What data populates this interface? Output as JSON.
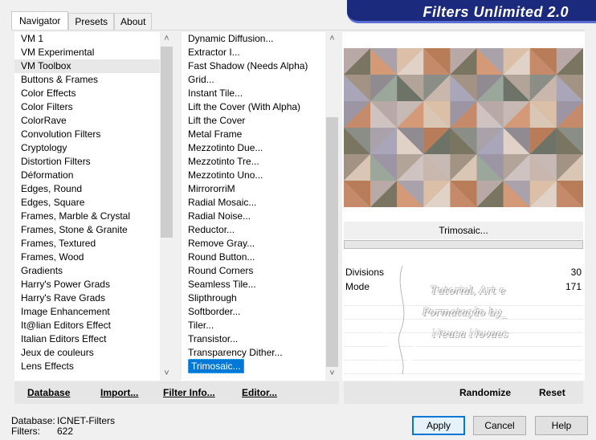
{
  "banner": {
    "title": "Filters Unlimited 2.0"
  },
  "tabs": [
    {
      "label": "Navigator",
      "active": true
    },
    {
      "label": "Presets",
      "active": false
    },
    {
      "label": "About",
      "active": false
    }
  ],
  "categories": [
    "VM 1",
    "VM Experimental",
    "VM Toolbox",
    "Buttons & Frames",
    "Color Effects",
    "Color Filters",
    "ColorRave",
    "Convolution Filters",
    "Cryptology",
    "Distortion Filters",
    "Déformation",
    "Edges, Round",
    "Edges, Square",
    "Frames, Marble & Crystal",
    "Frames, Stone & Granite",
    "Frames, Textured",
    "Frames, Wood",
    "Gradients",
    "Harry's Power Grads",
    "Harry's Rave Grads",
    "Image Enhancement",
    "It@lian Editors Effect",
    "Italian Editors Effect",
    "Jeux de couleurs",
    "Lens Effects"
  ],
  "categories_highlighted": "VM Toolbox",
  "filters": [
    "Dynamic Diffusion...",
    "Extractor I...",
    "Fast Shadow (Needs Alpha)",
    "Grid...",
    "Instant Tile...",
    "Lift the Cover (With Alpha)",
    "Lift the Cover",
    "Metal Frame",
    "Mezzotinto Due...",
    "Mezzotinto Tre...",
    "Mezzotinto Uno...",
    "MirrororriM",
    "Radial Mosaic...",
    "Radial Noise...",
    "Reductor...",
    "Remove Gray...",
    "Round Button...",
    "Round Corners",
    "Seamless Tile...",
    "Slipthrough",
    "Softborder...",
    "Tiler...",
    "Transistor...",
    "Transparency Dither...",
    "Trimosaic..."
  ],
  "filters_selected": "Trimosaic...",
  "preview": {
    "colors": [
      "#b8a9a6",
      "#c9b6ac",
      "#a9a2aa",
      "#d9c6b4",
      "#8f8b91",
      "#c48a6a",
      "#b3a49a",
      "#7a7560",
      "#c7b9b4",
      "#a8a6b8",
      "#dbbfa6",
      "#9aa79a",
      "#b97c58",
      "#cfc3c1",
      "#8a8e86",
      "#d49a78",
      "#a39384",
      "#e1d2c8",
      "#9c95a3",
      "#6e7368"
    ]
  },
  "selected_filter_name": "Trimosaic...",
  "params": [
    {
      "label": "Divisions",
      "value": "30"
    },
    {
      "label": "Mode",
      "value": "171"
    }
  ],
  "watermark": {
    "lines": [
      "Tutorial, Art e",
      "Formatação by_",
      "Neusa Novaes"
    ]
  },
  "toolbar_left": {
    "database": "Database",
    "import": "Import...",
    "filter_info": "Filter Info...",
    "editor": "Editor..."
  },
  "toolbar_right": {
    "randomize": "Randomize",
    "reset": "Reset"
  },
  "status": {
    "database_label": "Database:",
    "database_value": "ICNET-Filters",
    "filters_label": "Filters:",
    "filters_value": "622"
  },
  "buttons": {
    "apply": "Apply",
    "cancel": "Cancel",
    "help": "Help"
  }
}
